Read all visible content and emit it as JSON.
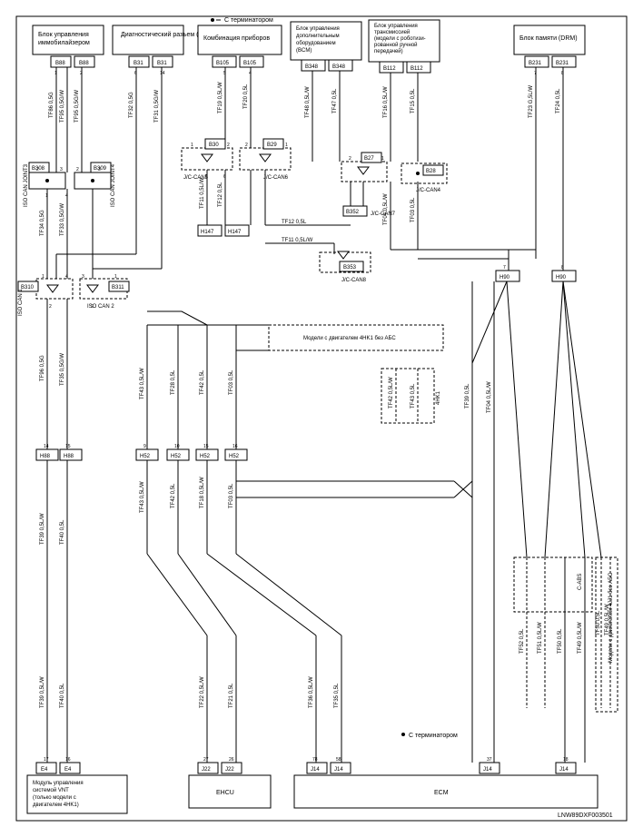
{
  "header": {
    "terminator_top": "С терминатором",
    "terminator_bottom": "С терминатором",
    "doc_id": "LNW89DXF003501"
  },
  "blocks": {
    "immobilizer": "Блок управления иммобилайзером",
    "diag_connector": "Диагностический разъем (DLC)",
    "instrument_cluster": "Комбинация приборов",
    "bcm": {
      "l1": "Блок управления",
      "l2": "дополнительным",
      "l3": "оборудованием",
      "l4": "(BCM)"
    },
    "tcm": {
      "l1": "Блок управления",
      "l2": "трансмиссией",
      "l3": "(модели с роботизи-",
      "l4": "рованной ручной",
      "l5": "передачей)"
    },
    "drm": "Блок памяти (DRM)",
    "iso_can_joint3": "ISO CAN JOINT3",
    "iso_can_joint4": "ISO CAN JOINT4",
    "iso_can1": "ISO CAN 1",
    "iso_can2": "ISO CAN 2",
    "jc_can5": "J/C-CAN5",
    "jc_can6": "J/C-CAN6",
    "jc_can7": "J/C-CAN7",
    "jc_can4": "J/C-CAN4",
    "jc_can8": "J/C-CAN8",
    "cabs": "C-ABS",
    "vnt": {
      "l1": "Модуль управления",
      "l2": "системой VNT",
      "l3": "(только модели с",
      "l4": "двигателем 4HK1)"
    },
    "ehcu": "EHCU",
    "ecm": "ECM",
    "hk1_noabs": "Модели с двигателем 4HK1 без АБС",
    "jj1_noabs": "Модели с двигателем 4JJ1 без АБС",
    "hk1": "4HK1"
  },
  "connectors": {
    "b88a": "B88",
    "b88b": "B88",
    "b31a": "B31",
    "b31b": "B31",
    "b105a": "B105",
    "b105b": "B105",
    "b348a": "B348",
    "b348b": "B348",
    "b112a": "B112",
    "b112b": "B112",
    "b231a": "B231",
    "b231b": "B231",
    "b308": "B308",
    "b309": "B309",
    "b310": "B310",
    "b311": "B311",
    "b30": "B30",
    "b29": "B29",
    "b27": "B27",
    "b28": "B28",
    "b352": "B352",
    "b353": "B353",
    "h147a": "H147",
    "h147b": "H147",
    "h88a": "H88",
    "h88b": "H88",
    "h52a": "H52",
    "h52b": "H52",
    "h52c": "H52",
    "h52d": "H52",
    "h90a": "H90",
    "h90b": "H90",
    "e4a": "E4",
    "e4b": "E4",
    "j22a": "J22",
    "j22b": "J22",
    "j14a": "J14",
    "j14b": "J14",
    "j14c": "J14",
    "j14d": "J14"
  },
  "wires": {
    "tf86": "TF86 0,5G",
    "tf95a": "TF95 0,5G/W",
    "tf95b": "TF95 0,5G/W",
    "tf32": "TF32 0,5G",
    "tf31": "TF31 0,5G/W",
    "tf19": "TF19 0,5L/W",
    "tf20": "TF20 0,5L",
    "tf48": "TF48 0,5L/W",
    "tf47": "TF47 0,5L",
    "tf16": "TF16 0,5L/W",
    "tf15": "TF15 0,5L",
    "tf23": "TF23 G,5L/W",
    "tf24": "TF24 0,5L",
    "tf34": "TF34 0,5G",
    "tf33": "TF33 0,5G/W",
    "tf11a": "TF11 0,5L/W",
    "tf12a": "TF12 0,5L",
    "tf11b": "TF11 0,5L/W",
    "tf12b": "TF12 0,5L",
    "tf04": "TF04 0,5L/W",
    "tf03": "TF03 0,5L",
    "tf96": "TF96 0,5G",
    "tf35": "TF35 0,5G/W",
    "tf43a": "TF43 0,5L/W",
    "tf28a": "TF28 0,5L",
    "tf42a": "TF42 0,5L",
    "tf03a": "TF03 0,5L",
    "tf43b": "TF43 0,5L/W",
    "tf42b": "TF42 0,5L",
    "tf18b": "TF18 0,5L/W",
    "tf03b": "TF03 0,5L",
    "tf39a": "TF39 0,5L/W",
    "tf40a": "TF40 0,5L",
    "tf39b": "TF39 0,5L/W",
    "tf40b": "TF40 0,5L",
    "tf22": "TF22 0,5L/W",
    "tf21": "TF21 0,5L",
    "tf36": "TF36 0,5L/W",
    "tf35b": "TF35 0,5L",
    "tf43c": "TF43 0,5L",
    "tf42c": "TF42 0,5L/W",
    "tf39c": "TF39 0,5L",
    "tf04c": "TF04 0,5L/W",
    "tf52": "TF52 0,5L",
    "tf51": "TF51 0,5L/W",
    "tf50a": "TF50 0,5L",
    "tf49a": "TF49 0,5L/W",
    "tf50b": "TF50 0,5L",
    "tf49b": "TF49 0,5L/W"
  },
  "pins": {
    "p1": "1",
    "p2": "2",
    "p3": "3",
    "p4": "4",
    "p5": "5",
    "p6": "6",
    "p7": "7",
    "p8": "8",
    "p9": "9",
    "p10": "10",
    "p14": "14",
    "p15": "15",
    "p16": "16",
    "p17": "17",
    "p18": "18",
    "p26": "26",
    "p27": "27",
    "p37": "37",
    "p58": "58",
    "p78": "78"
  }
}
